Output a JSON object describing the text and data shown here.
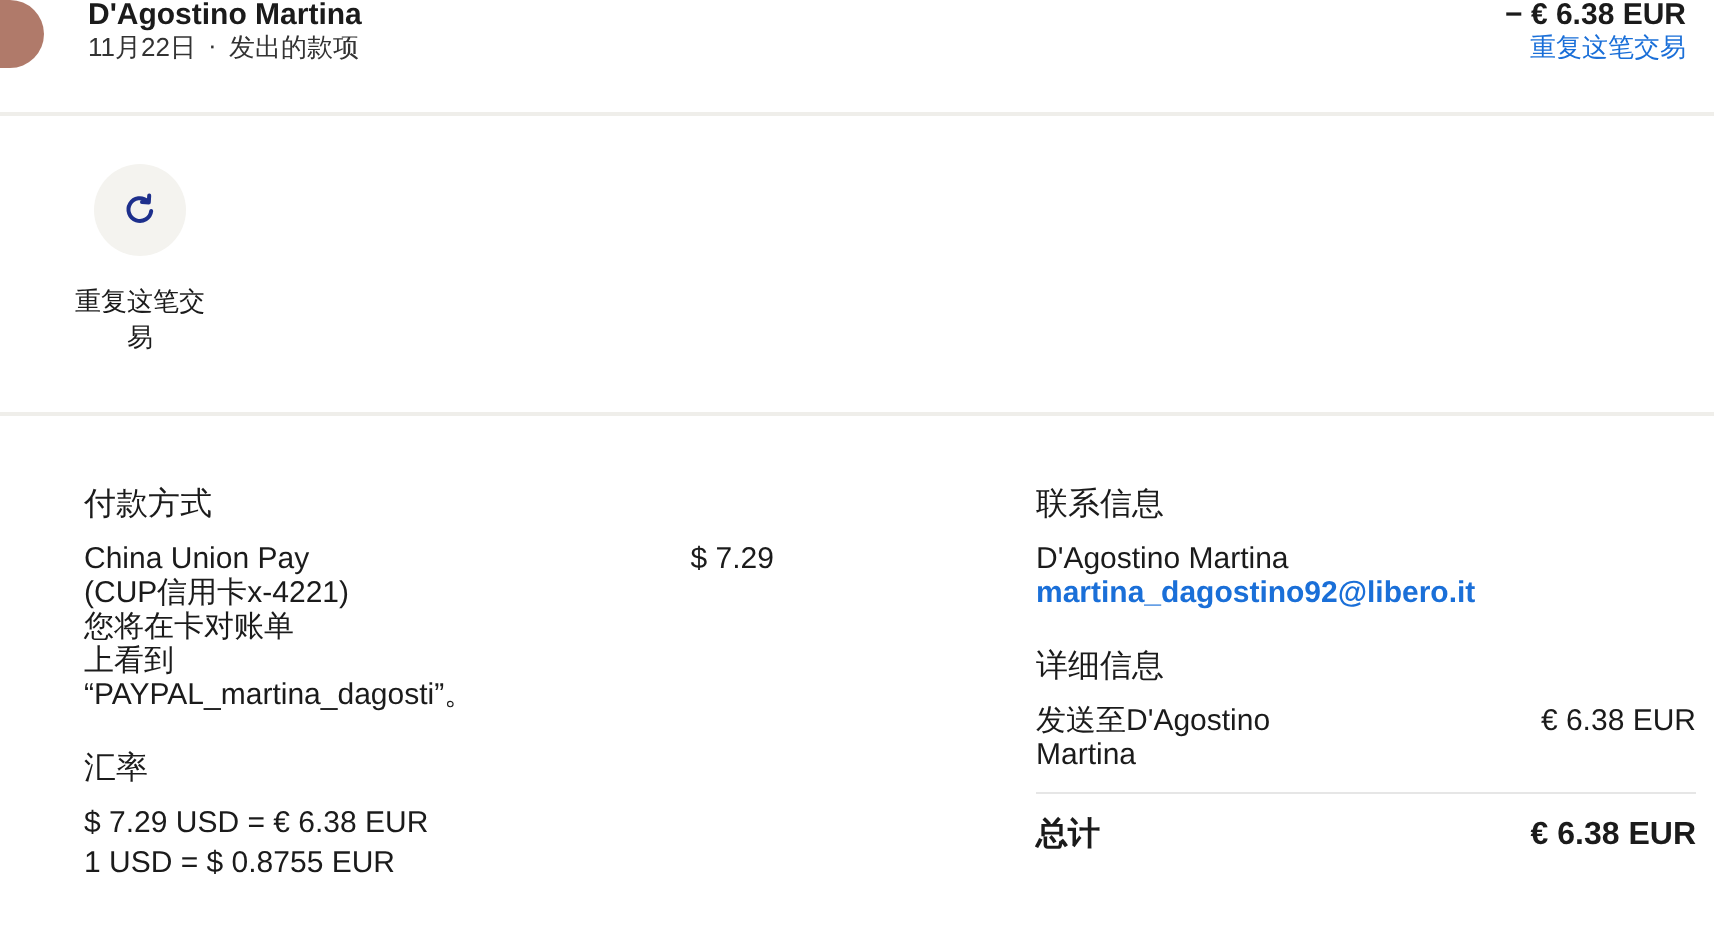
{
  "header": {
    "name": "D'Agostino Martina",
    "date": "11月22日",
    "separator": "·",
    "type": "发出的款项",
    "amount": "− € 6.38 EUR",
    "repeat_link": "重复这笔交易"
  },
  "actions": [
    {
      "label": "重复这笔交易",
      "kind": "repeat"
    }
  ],
  "payment": {
    "heading": "付款方式",
    "lines": [
      "China Union Pay",
      "(CUP信用卡x-4221)",
      "您将在卡对账单",
      "上看到",
      "“PAYPAL_martina_dagosti”。"
    ],
    "amount": "$ 7.29"
  },
  "exchange": {
    "heading": "汇率",
    "lines": [
      "$ 7.29 USD = € 6.38 EUR",
      "1 USD = $ 0.8755 EUR"
    ]
  },
  "contact": {
    "heading": "联系信息",
    "name": "D'Agostino Martina",
    "email": "martina_dagostino92@libero.it"
  },
  "details": {
    "heading": "详细信息",
    "rows": [
      {
        "label": "发送至D'Agostino Martina",
        "value": "€ 6.38 EUR",
        "kind": "item"
      },
      {
        "label": "总计",
        "value": "€ 6.38 EUR",
        "kind": "total"
      }
    ]
  }
}
